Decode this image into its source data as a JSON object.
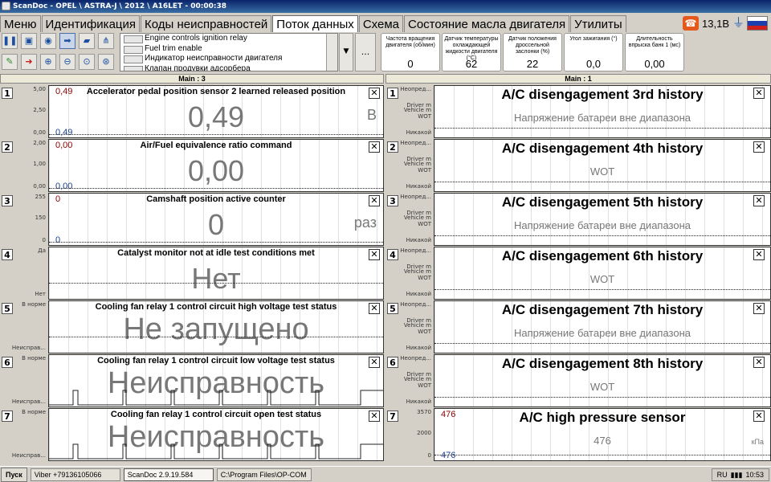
{
  "window": {
    "title": "ScanDoc - OPEL \\ ASTRA-J \\ 2012 \\ A16LET - 00:00:38"
  },
  "tabs": [
    "Меню",
    "Идентификация",
    "Коды неисправностей",
    "Поток данных",
    "Схема",
    "Состояние масла двигателя",
    "Утилиты"
  ],
  "active_tab": 3,
  "status": {
    "voltage": "13,1В",
    "phone_icon": "phone-icon",
    "plug_icon": "plug-icon"
  },
  "flag_colors": [
    "#ffffff",
    "#1c3fae",
    "#d0201c"
  ],
  "param_list": [
    "Engine controls ignition relay",
    "Fuel trim enable",
    "Индикатор неисправности двигателя",
    "Клапан продувки адсорбера"
  ],
  "more_label": "...",
  "summary": [
    {
      "label": "Частота вращения двигателя (об/мин)",
      "value": "0"
    },
    {
      "label": "Датчик температуры охлаждающей жидкости двигателя (°С)",
      "value": "62"
    },
    {
      "label": "Датчик положения дроссельной заслонки (%)",
      "value": "22"
    },
    {
      "label": "Угол зажигания (°)",
      "value": "0,0"
    },
    {
      "label": "Длительность впрыска банк 1 (мс)",
      "value": "0,00"
    }
  ],
  "left_panel": {
    "header": "Main : 3",
    "rows": [
      {
        "num": "1",
        "name": "Accelerator pedal position sensor 2 learned released position",
        "value": "0,49",
        "unit": "В",
        "axis": [
          "5,00",
          "2,50",
          "0,00"
        ],
        "vtop": "0,49",
        "vbot": "0,49"
      },
      {
        "num": "2",
        "name": "Air/Fuel equivalence ratio command",
        "value": "0,00",
        "unit": "",
        "axis": [
          "2,00",
          "1,00",
          "0,00"
        ],
        "vtop": "0,00",
        "vbot": "0,00"
      },
      {
        "num": "3",
        "name": "Camshaft position active counter",
        "value": "0",
        "unit": "раз",
        "axis": [
          "255",
          "150",
          "0"
        ],
        "vtop": "0",
        "vbot": "0"
      },
      {
        "num": "4",
        "name": "Catalyst monitor not at idle test conditions met",
        "value": "Нет",
        "unit": "",
        "axis": [
          "Да",
          "",
          "Нет"
        ],
        "vtop": "",
        "vbot": ""
      },
      {
        "num": "5",
        "name": "Cooling fan relay 1 control circuit high voltage test status",
        "value": "Не запущено",
        "unit": "",
        "axis": [
          "В норме",
          "",
          "Неисправ..."
        ],
        "vtop": "",
        "vbot": ""
      },
      {
        "num": "6",
        "name": "Cooling fan relay 1 control circuit low voltage test status",
        "value": "Неисправность",
        "unit": "",
        "axis": [
          "В норме",
          "",
          "Неисправ..."
        ],
        "vtop": "",
        "vbot": ""
      },
      {
        "num": "7",
        "name": "Cooling fan relay 1 control circuit open test status",
        "value": "Неисправность",
        "unit": "",
        "axis": [
          "В норме",
          "",
          "Неисправ..."
        ],
        "vtop": "",
        "vbot": ""
      }
    ]
  },
  "right_panel": {
    "header": "Main : 1",
    "rows": [
      {
        "num": "1",
        "name": "A/C disengagement 3rd history",
        "value": "Напряжение батареи вне диапазона",
        "axis": [
          "Неопред...",
          "Driver m",
          "Vehicle m",
          "WOT",
          "Никакой"
        ]
      },
      {
        "num": "2",
        "name": "A/C disengagement 4th history",
        "value": "WOT",
        "axis": [
          "Неопред...",
          "Driver m",
          "Vehicle m",
          "WOT",
          "Никакой"
        ]
      },
      {
        "num": "3",
        "name": "A/C disengagement 5th history",
        "value": "Напряжение батареи вне диапазона",
        "axis": [
          "Неопред...",
          "Driver m",
          "Vehicle m",
          "WOT",
          "Никакой"
        ]
      },
      {
        "num": "4",
        "name": "A/C disengagement 6th history",
        "value": "WOT",
        "axis": [
          "Неопред...",
          "Driver m",
          "Vehicle m",
          "WOT",
          "Никакой"
        ]
      },
      {
        "num": "5",
        "name": "A/C disengagement 7th history",
        "value": "Напряжение батареи вне диапазона",
        "axis": [
          "Неопред...",
          "Driver m",
          "Vehicle m",
          "WOT",
          "Никакой"
        ]
      },
      {
        "num": "6",
        "name": "A/C disengagement 8th history",
        "value": "WOT",
        "axis": [
          "Неопред...",
          "Driver m",
          "Vehicle m",
          "WOT",
          "Никакой"
        ]
      },
      {
        "num": "7",
        "name": "A/C high pressure sensor",
        "value": "476",
        "unit": "кПа",
        "axis": [
          "3570",
          "2000",
          "0"
        ],
        "vtop": "476",
        "vbot": "476"
      }
    ]
  },
  "taskbar": {
    "start": "Пуск",
    "items": [
      "Viber +79136105066",
      "ScanDoc 2.9.19.584",
      "C:\\Program Files\\OP-COM"
    ],
    "active_item": 1,
    "lang": "RU",
    "clock": "10:53"
  }
}
